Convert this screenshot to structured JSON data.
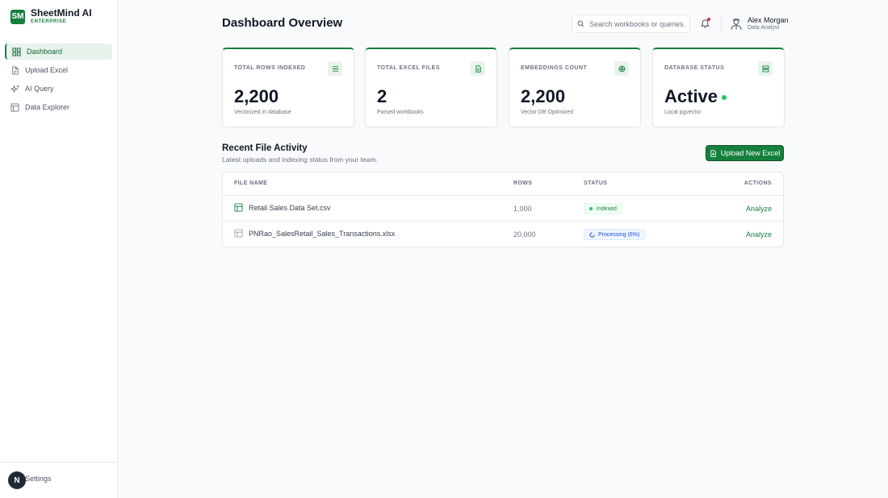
{
  "brand": {
    "logo": "SM",
    "name": "SheetMind AI",
    "tier": "ENTERPRISE"
  },
  "nav": {
    "items": [
      {
        "label": "Dashboard",
        "icon": "grid-icon"
      },
      {
        "label": "Upload Excel",
        "icon": "file-icon"
      },
      {
        "label": "AI Query",
        "icon": "sparkles-icon"
      },
      {
        "label": "Data Explorer",
        "icon": "table-icon"
      }
    ],
    "settings": "Settings",
    "badge": "N"
  },
  "header": {
    "title": "Dashboard Overview",
    "search_placeholder": "Search workbooks or queries..",
    "user": {
      "name": "Alex Morgan",
      "role": "Data Analyst"
    }
  },
  "stats": [
    {
      "label": "TOTAL ROWS INDEXED",
      "value": "2,200",
      "sub": "Vectorized in database",
      "icon": "list-icon"
    },
    {
      "label": "TOTAL EXCEL FILES",
      "value": "2",
      "sub": "Parsed workbooks",
      "icon": "file-text-icon"
    },
    {
      "label": "EMBEDDINGS COUNT",
      "value": "2,200",
      "sub": "Vector DB Optimized",
      "icon": "cpu-icon"
    },
    {
      "label": "DATABASE STATUS",
      "value": "Active",
      "sub": "Local pgvector",
      "icon": "server-icon"
    }
  ],
  "activity": {
    "title": "Recent File Activity",
    "subtitle": "Latest uploads and indexing status from your team.",
    "upload_label": "Upload New Excel",
    "columns": [
      "FILE NAME",
      "ROWS",
      "STATUS",
      "ACTIONS"
    ],
    "rows": [
      {
        "file": "Retail Sales Data Set.csv",
        "rows": "1,000",
        "status": "Indexed",
        "action": "Analyze"
      },
      {
        "file": "PNRao_SalesRetail_Sales_Transactions.xlsx",
        "rows": "20,000",
        "status": "Processing (6%)",
        "action": "Analyze"
      }
    ]
  },
  "colors": {
    "accent": "#15803d",
    "active_dot": "#22c55e",
    "processing": "#1d4ed8",
    "notification": "#dc2626"
  }
}
